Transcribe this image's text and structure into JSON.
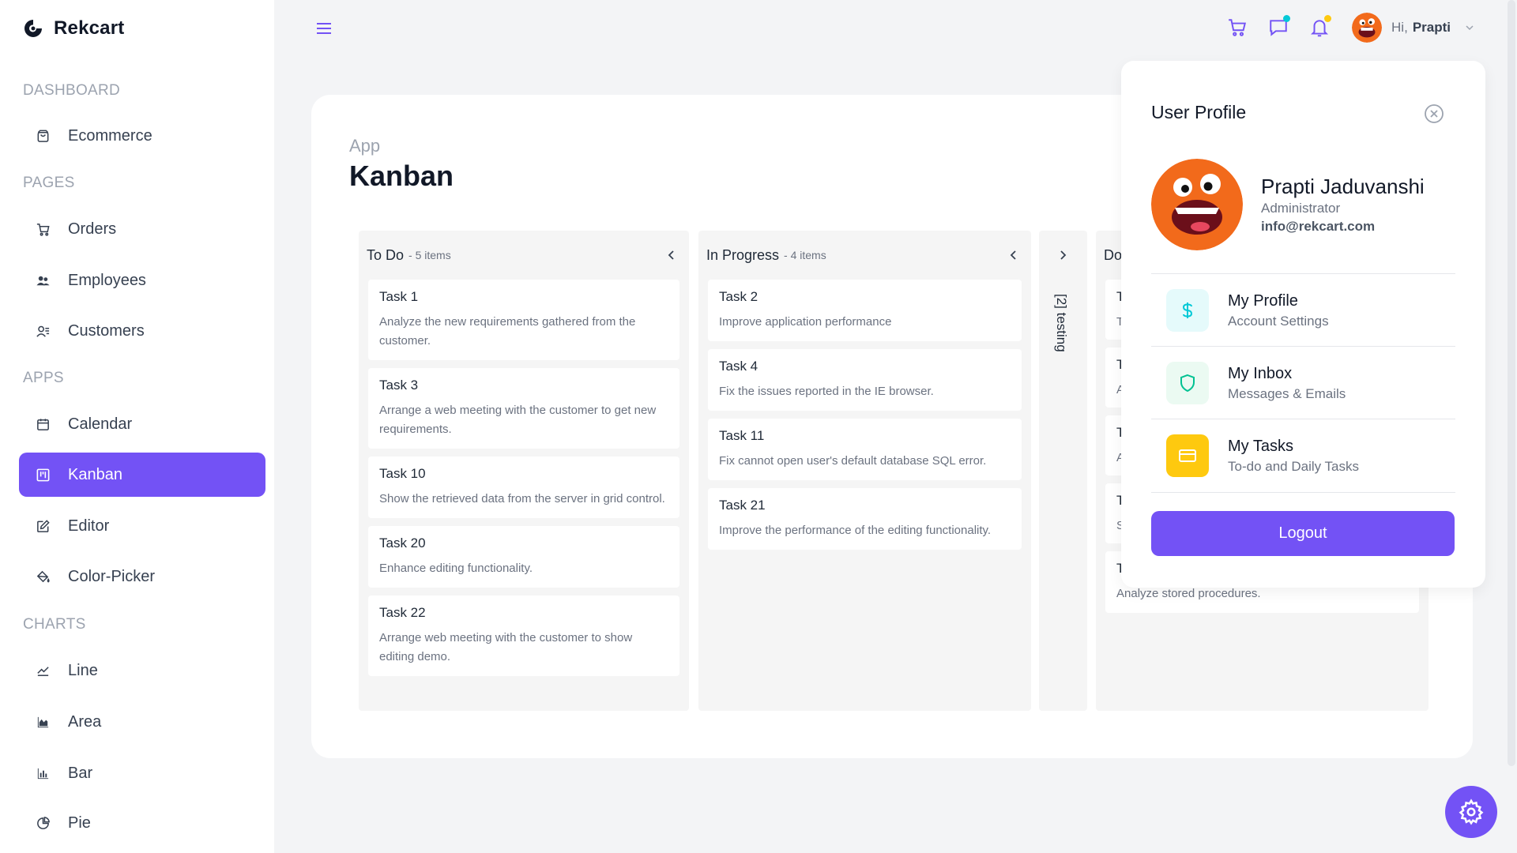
{
  "app": {
    "brand": "Rekcart"
  },
  "sidebar": {
    "sections": [
      {
        "title": "DASHBOARD",
        "items": [
          {
            "label": "Ecommerce",
            "icon": "shopping-bag-icon"
          }
        ]
      },
      {
        "title": "PAGES",
        "items": [
          {
            "label": "Orders",
            "icon": "cart-icon"
          },
          {
            "label": "Employees",
            "icon": "users-icon"
          },
          {
            "label": "Customers",
            "icon": "customers-icon"
          }
        ]
      },
      {
        "title": "APPS",
        "items": [
          {
            "label": "Calendar",
            "icon": "calendar-icon"
          },
          {
            "label": "Kanban",
            "icon": "kanban-icon",
            "active": true
          },
          {
            "label": "Editor",
            "icon": "edit-icon"
          },
          {
            "label": "Color-Picker",
            "icon": "color-picker-icon"
          }
        ]
      },
      {
        "title": "CHARTS",
        "items": [
          {
            "label": "Line",
            "icon": "line-chart-icon"
          },
          {
            "label": "Area",
            "icon": "area-chart-icon"
          },
          {
            "label": "Bar",
            "icon": "bar-chart-icon"
          },
          {
            "label": "Pie",
            "icon": "pie-chart-icon"
          }
        ]
      }
    ]
  },
  "header": {
    "greeting": "Hi,",
    "username": "Prapti",
    "chat_dot_color": "#03c9d7",
    "bell_dot_color": "#fec90f"
  },
  "page": {
    "breadcrumb": "App",
    "title": "Kanban"
  },
  "kanban": {
    "todo": {
      "title": "To Do",
      "count": "- 5 items",
      "cards": [
        {
          "title": "Task 1",
          "desc": "Analyze the new requirements gathered from the customer."
        },
        {
          "title": "Task 3",
          "desc": "Arrange a web meeting with the customer to get new requirements."
        },
        {
          "title": "Task 10",
          "desc": "Show the retrieved data from the server in grid control."
        },
        {
          "title": "Task 20",
          "desc": "Enhance editing functionality."
        },
        {
          "title": "Task 22",
          "desc": "Arrange web meeting with the customer to show editing demo."
        }
      ]
    },
    "inprogress": {
      "title": "In Progress",
      "count": "- 4 items",
      "cards": [
        {
          "title": "Task 2",
          "desc": "Improve application performance"
        },
        {
          "title": "Task 4",
          "desc": "Fix the issues reported in the IE browser."
        },
        {
          "title": "Task 11",
          "desc": "Fix cannot open user's default database SQL error."
        },
        {
          "title": "Task 21",
          "desc": "Improve the performance of the editing functionality."
        }
      ]
    },
    "testing": {
      "label": "[2] testing"
    },
    "done": {
      "title": "Do",
      "visible_letters": [
        "T",
        "T",
        "T",
        "T",
        "T",
        "T"
      ],
      "second_letters": [
        "T",
        "A",
        "A",
        "S"
      ],
      "last_desc": "Analyze stored procedures."
    }
  },
  "profile": {
    "title": "User Profile",
    "name": "Prapti Jaduvanshi",
    "role": "Administrator",
    "email": "info@rekcart.com",
    "menu": [
      {
        "title": "My Profile",
        "sub": "Account Settings",
        "icon": "dollar-icon",
        "icon_color": "#03c9d7",
        "bg": "#e5fafb"
      },
      {
        "title": "My Inbox",
        "sub": "Messages & Emails",
        "icon": "shield-icon",
        "icon_color": "#00c292",
        "bg": "#ebfaf2"
      },
      {
        "title": "My Tasks",
        "sub": "To-do and Daily Tasks",
        "icon": "card-icon",
        "icon_color": "#ffffff",
        "bg": "#fec90f"
      }
    ],
    "logout": "Logout"
  },
  "colors": {
    "accent": "#7352f5"
  }
}
